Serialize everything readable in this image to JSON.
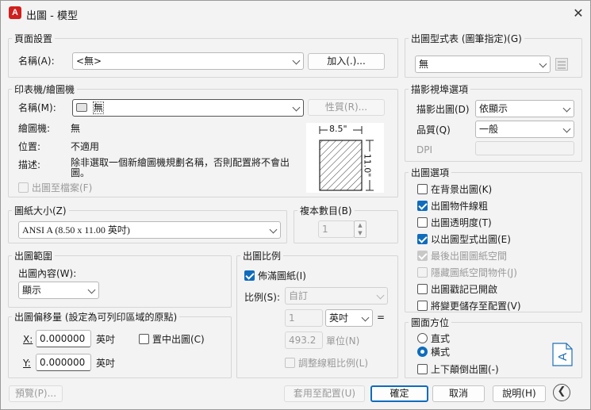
{
  "window": {
    "title": "出圖 - 模型",
    "app_icon": "A",
    "accent": "#0f6cbd"
  },
  "page_setup": {
    "legend": "頁面設置",
    "name_label": "名稱(A):",
    "name_value": "<無>",
    "add_button": "加入(.)..."
  },
  "plotter": {
    "legend": "印表機/繪圖機",
    "name_label": "名稱(M):",
    "name_value": "無",
    "properties_button": "性質(R)...",
    "plotter_label": "繪圖機:",
    "plotter_value": "無",
    "location_label": "位置:",
    "location_value": "不適用",
    "description_label": "描述:",
    "description_value": "除非選取一個新繪圖機規劃名稱，否則配置將不會出圖。",
    "plot_to_file_label": "出圖至檔案(F)",
    "plot_to_file_checked": false,
    "preview_width": "8.5\"",
    "preview_height": "11.0\""
  },
  "paper_size": {
    "legend": "圖紙大小(Z)",
    "value": "ANSI A (8.50 x 11.00 英吋)"
  },
  "copies": {
    "legend": "複本數目(B)",
    "value": "1"
  },
  "plot_area": {
    "legend": "出圖範圍",
    "what_label": "出圖內容(W):",
    "what_value": "顯示"
  },
  "plot_offset": {
    "legend": "出圖偏移量 (設定為可列印區域的原點)",
    "x_label": "X:",
    "x_value": "0.000000",
    "x_unit": "英吋",
    "y_label": "Y:",
    "y_value": "0.000000",
    "y_unit": "英吋",
    "center_label": "置中出圖(C)",
    "center_checked": false
  },
  "plot_scale": {
    "legend": "出圖比例",
    "fit_label": "佈滿圖紙(I)",
    "fit_checked": true,
    "scale_label": "比例(S):",
    "scale_value": "自訂",
    "num_value": "1",
    "unit_value": "英吋",
    "equals": "=",
    "den_value": "493.2",
    "den_unit_label": "單位(N)",
    "lineweights_label": "調整線粗比例(L)",
    "lineweights_checked": false
  },
  "plot_style_table": {
    "legend": "出圖型式表 (圖筆指定)(G)",
    "value": "無"
  },
  "shaded_viewport": {
    "legend": "描影視埠選項",
    "shade_label": "描影出圖(D)",
    "shade_value": "依顯示",
    "quality_label": "品質(Q)",
    "quality_value": "一般",
    "dpi_label": "DPI",
    "dpi_value": ""
  },
  "plot_options": {
    "legend": "出圖選項",
    "items": [
      {
        "label": "在背景出圖(K)",
        "checked": false,
        "disabled": false
      },
      {
        "label": "出圖物件線粗",
        "checked": true,
        "disabled": false
      },
      {
        "label": "出圖透明度(T)",
        "checked": false,
        "disabled": false
      },
      {
        "label": "以出圖型式出圖(E)",
        "checked": true,
        "disabled": false
      },
      {
        "label": "最後出圖圖紙空間",
        "checked": true,
        "disabled": true
      },
      {
        "label": "隱藏圖紙空間物件(J)",
        "checked": false,
        "disabled": true
      },
      {
        "label": "出圖戳記已開啟",
        "checked": false,
        "disabled": false
      },
      {
        "label": "將變更儲存至配置(V)",
        "checked": false,
        "disabled": false
      }
    ]
  },
  "orientation": {
    "legend": "圖面方位",
    "portrait_label": "直式",
    "landscape_label": "橫式",
    "selected": "landscape",
    "upside_down_label": "上下顛倒出圖(-)",
    "upside_down_checked": false
  },
  "footer": {
    "preview_button": "預覽(P)...",
    "apply_button": "套用至配置(U)",
    "ok_button": "確定",
    "cancel_button": "取消",
    "help_button": "說明(H)"
  }
}
